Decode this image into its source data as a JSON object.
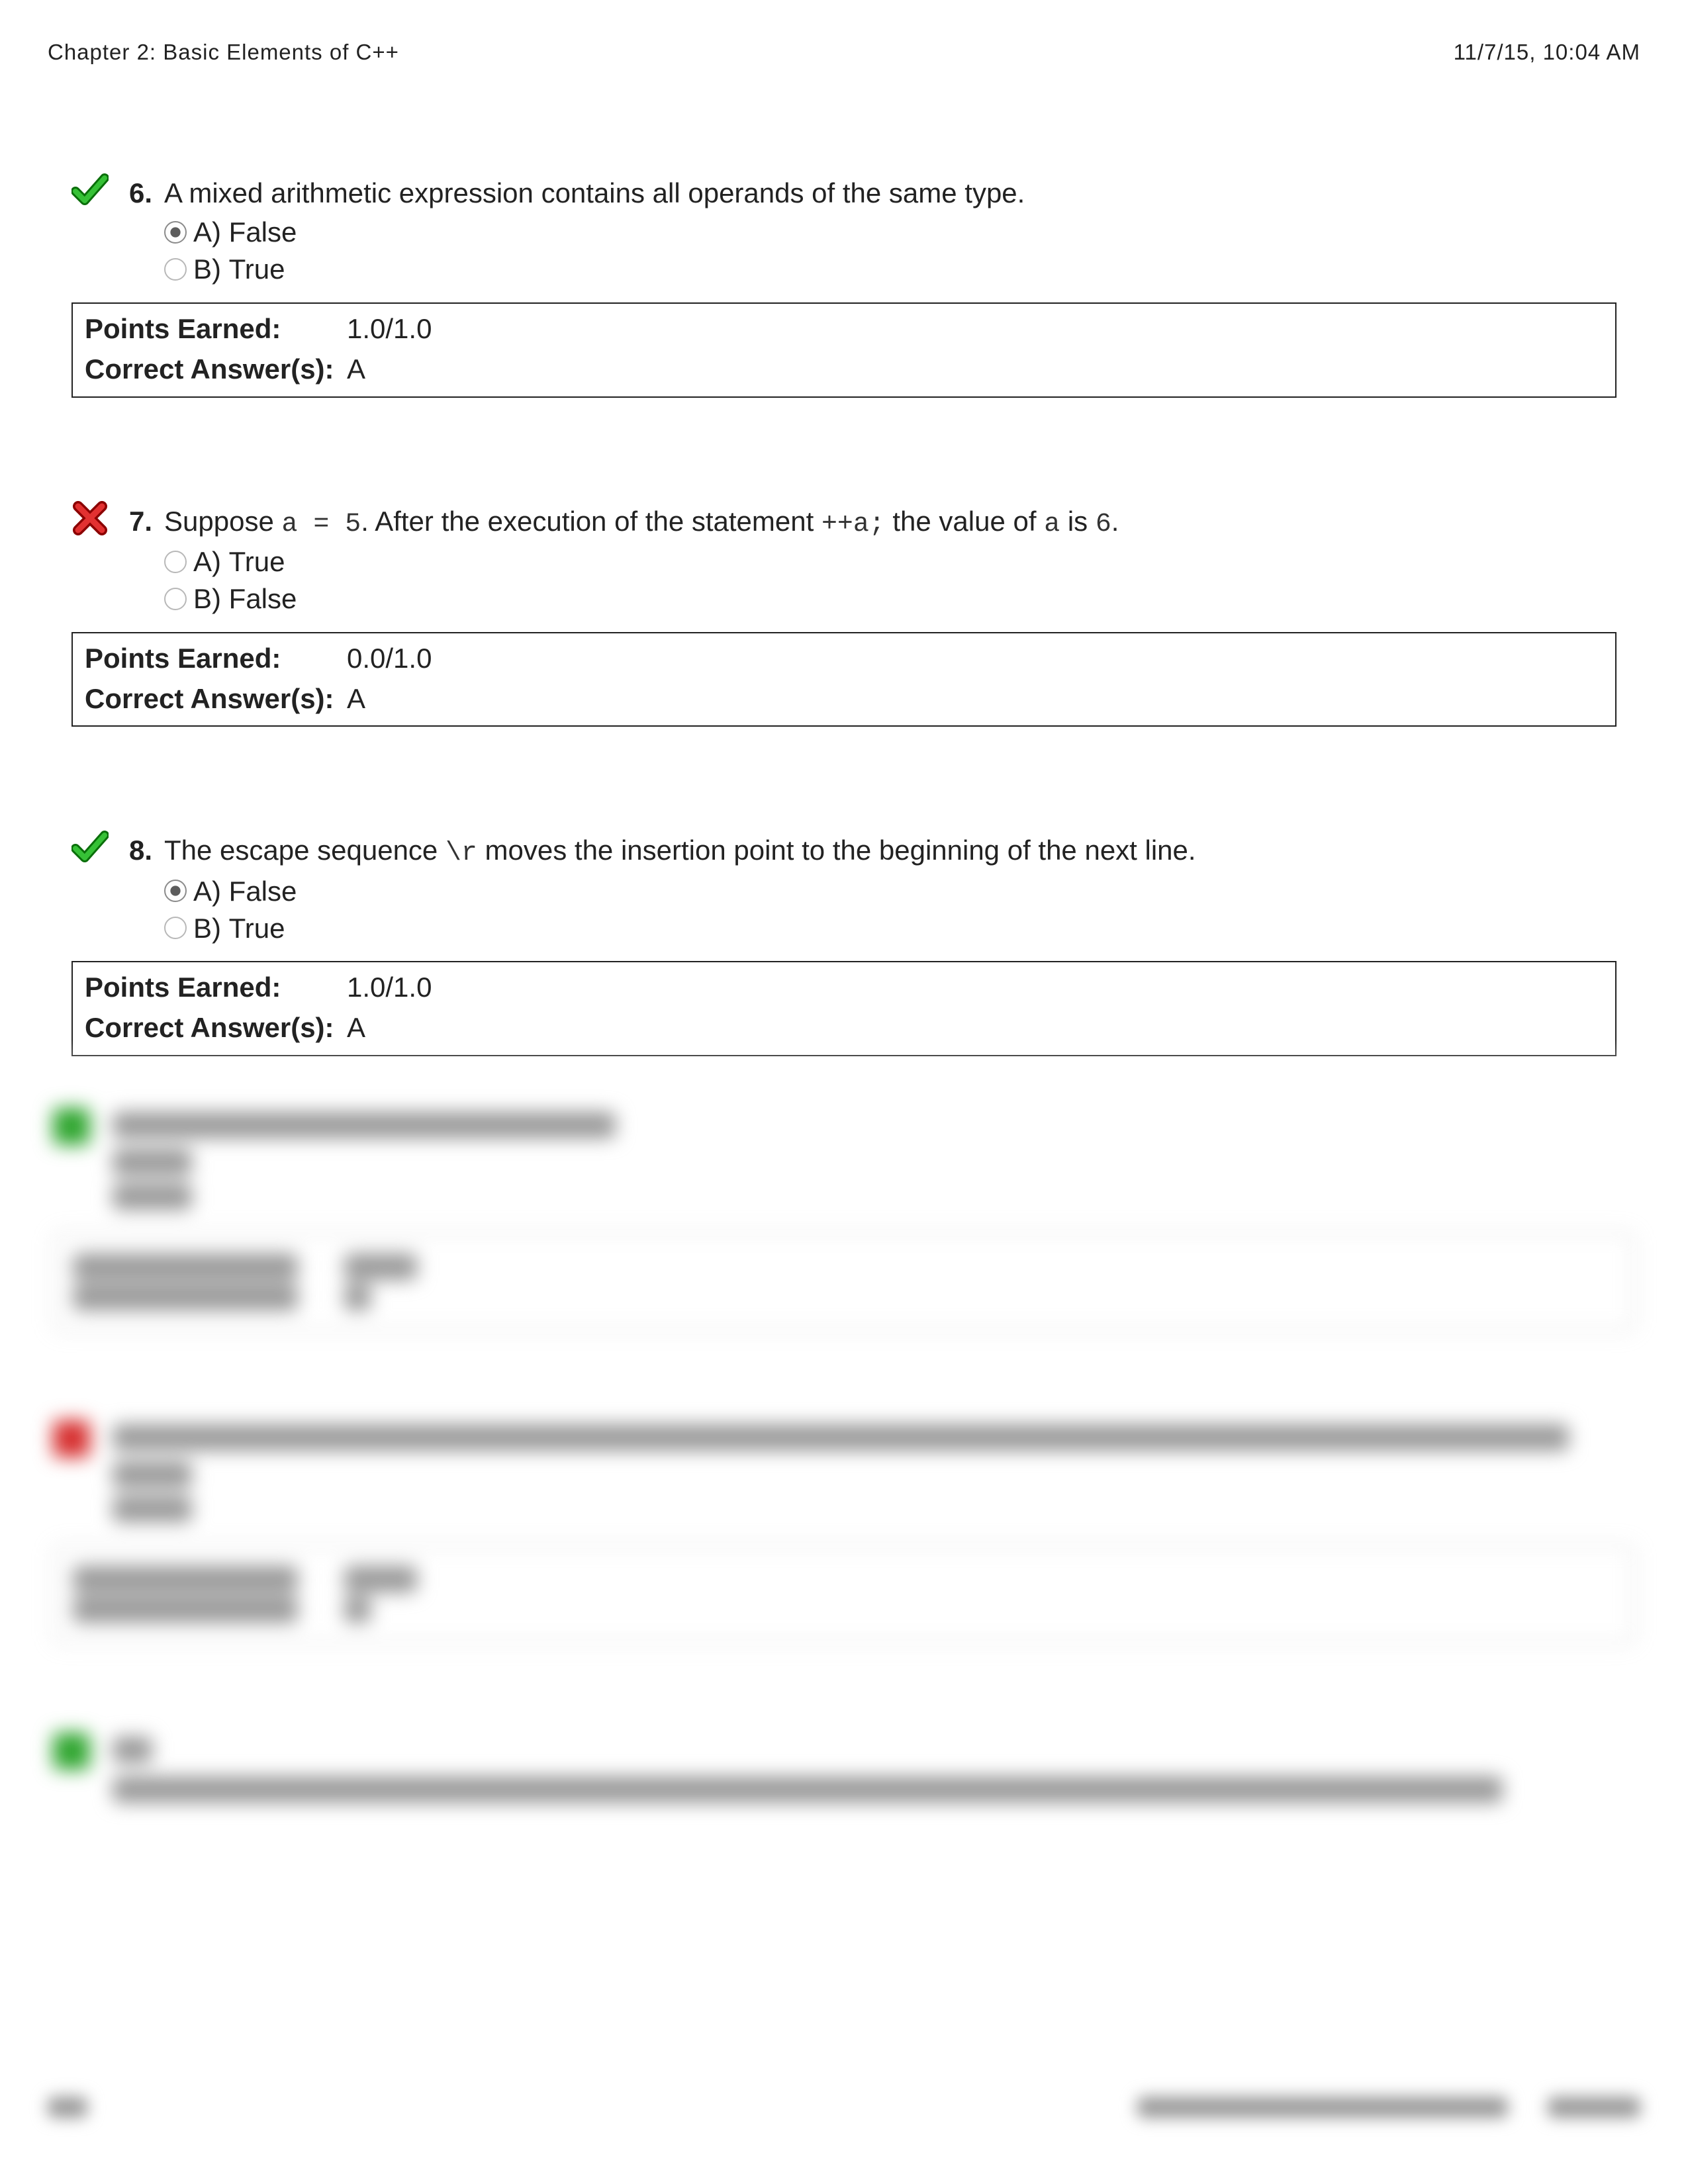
{
  "header": {
    "title": "Chapter 2: Basic Elements of C++",
    "timestamp": "11/7/15, 10:04 AM"
  },
  "labels": {
    "points_earned": "Points Earned:",
    "correct_answers": "Correct Answer(s):"
  },
  "questions": [
    {
      "number": "6.",
      "status": "correct",
      "prompt_segments": [
        {
          "t": "text",
          "v": "A mixed arithmetic expression contains all operands of the same type."
        }
      ],
      "options": [
        {
          "letter": "A)",
          "label": "False",
          "selected": true
        },
        {
          "letter": "B)",
          "label": "True",
          "selected": false
        }
      ],
      "points": "1.0/1.0",
      "correct": "A"
    },
    {
      "number": "7.",
      "status": "incorrect",
      "prompt_segments": [
        {
          "t": "text",
          "v": "Suppose "
        },
        {
          "t": "code",
          "v": "a = 5"
        },
        {
          "t": "text",
          "v": ". After the execution of the statement "
        },
        {
          "t": "code",
          "v": "++a;"
        },
        {
          "t": "text",
          "v": " the value of "
        },
        {
          "t": "code",
          "v": "a"
        },
        {
          "t": "text",
          "v": " is "
        },
        {
          "t": "code",
          "v": "6"
        },
        {
          "t": "text",
          "v": "."
        }
      ],
      "options": [
        {
          "letter": "A)",
          "label": "True",
          "selected": false
        },
        {
          "letter": "B)",
          "label": "False",
          "selected": false
        }
      ],
      "points": "0.0/1.0",
      "correct": "A"
    },
    {
      "number": "8.",
      "status": "correct",
      "prompt_segments": [
        {
          "t": "text",
          "v": "The escape sequence "
        },
        {
          "t": "code",
          "v": "\\r"
        },
        {
          "t": "text",
          "v": " moves the insertion point to the beginning of the next line."
        }
      ],
      "options": [
        {
          "letter": "A)",
          "label": "False",
          "selected": true
        },
        {
          "letter": "B)",
          "label": "True",
          "selected": false
        }
      ],
      "points": "1.0/1.0",
      "correct": "A"
    }
  ]
}
